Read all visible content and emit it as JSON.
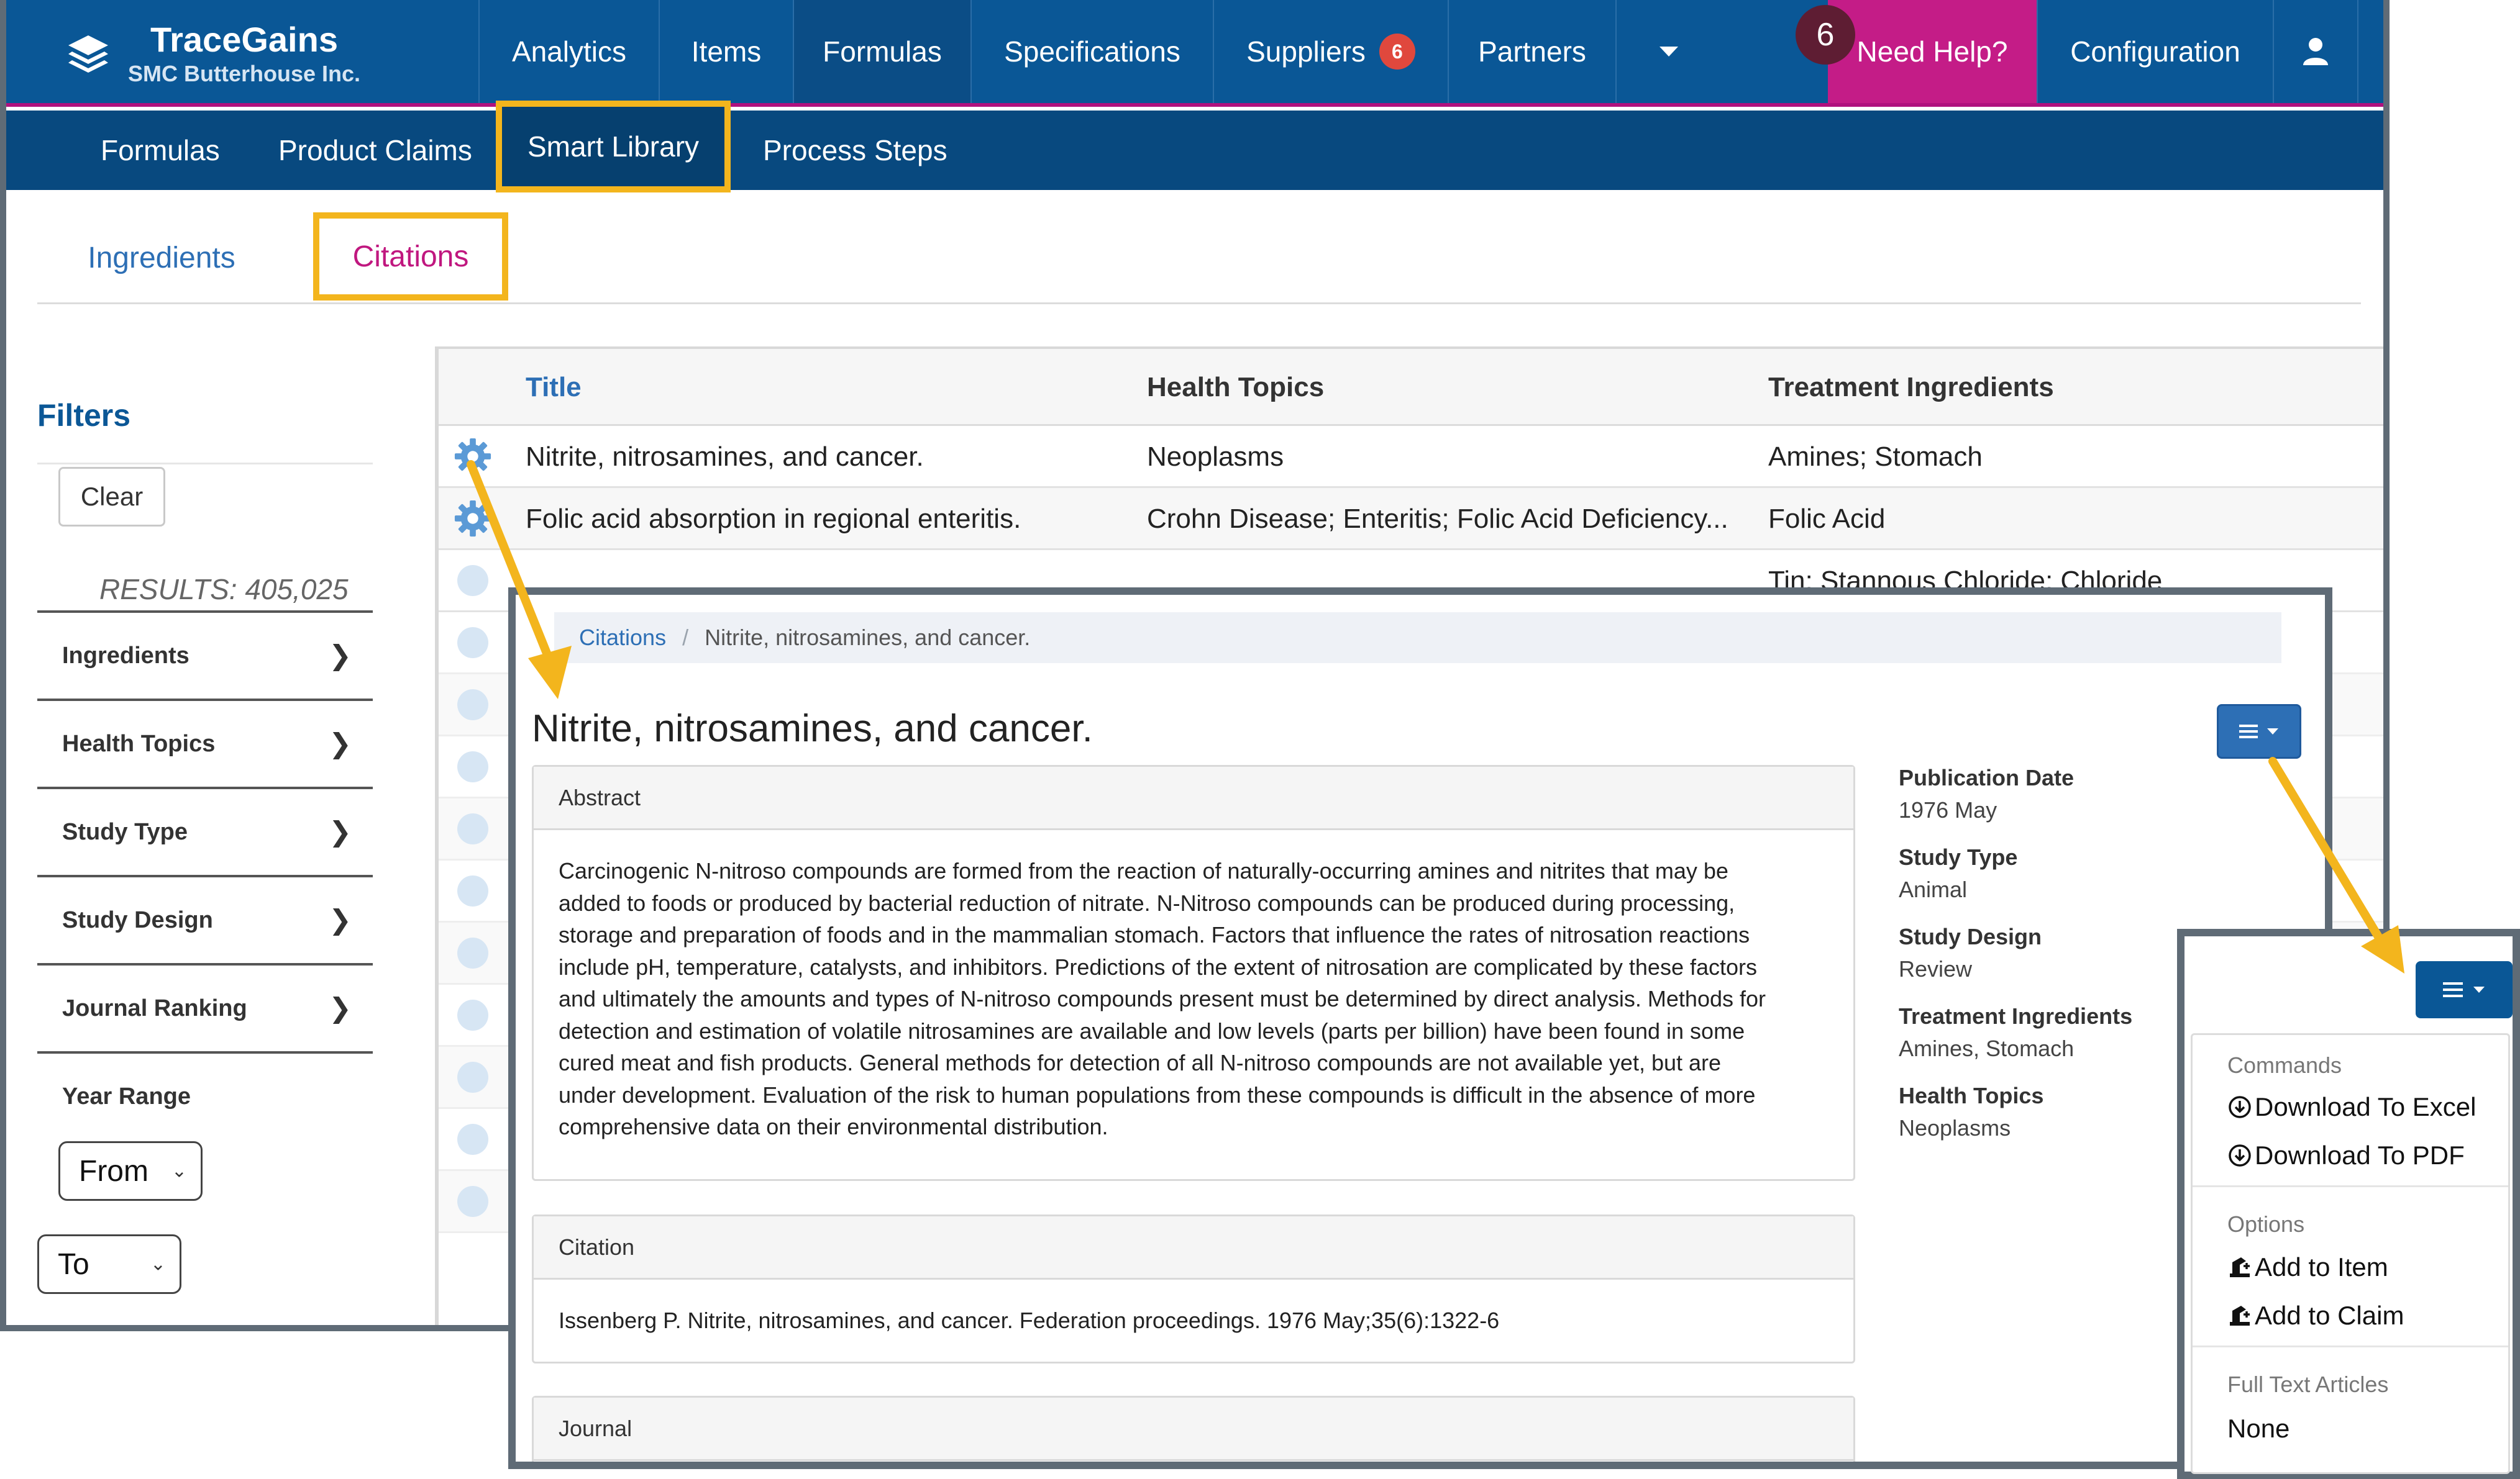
{
  "app": {
    "brand_name": "TraceGains",
    "org_name": "SMC Butterhouse Inc."
  },
  "nav": {
    "items": [
      {
        "label": "Analytics"
      },
      {
        "label": "Items"
      },
      {
        "label": "Formulas",
        "active": true
      },
      {
        "label": "Specifications"
      },
      {
        "label": "Suppliers",
        "badge": "6"
      },
      {
        "label": "Partners"
      }
    ],
    "help_label": "Need Help?",
    "help_count": "6",
    "config_label": "Configuration"
  },
  "subnav": {
    "items": [
      "Formulas",
      "Product Claims",
      "Smart Library",
      "Process Steps"
    ]
  },
  "tabs": {
    "ingredients": "Ingredients",
    "citations": "Citations"
  },
  "filters": {
    "title": "Filters",
    "clear": "Clear",
    "results": "RESULTS: 405,025",
    "facets": [
      "Ingredients",
      "Health Topics",
      "Study Type",
      "Study Design",
      "Journal Ranking"
    ],
    "year_range": "Year Range",
    "from": "From",
    "to": "To"
  },
  "table": {
    "headers": [
      "Title",
      "Health Topics",
      "Treatment Ingredients"
    ],
    "rows": [
      {
        "title": "Nitrite, nitrosamines, and cancer.",
        "topics": "Neoplasms",
        "ingredients": "Amines; Stomach"
      },
      {
        "title": "Folic acid absorption in regional enteritis.",
        "topics": "Crohn Disease; Enteritis; Folic Acid Deficiency...",
        "ingredients": "Folic Acid"
      },
      {
        "title": "",
        "topics": "",
        "ingredients": "Tin; Stannous Chloride; Chloride"
      }
    ]
  },
  "detail": {
    "breadcrumb_root": "Citations",
    "breadcrumb_current": "Nitrite, nitrosamines, and cancer.",
    "title": "Nitrite, nitrosamines, and cancer.",
    "abstract_label": "Abstract",
    "abstract_lines": [
      "Carcinogenic N-nitroso compounds are formed from the reaction of naturally-occurring amines and nitrites that may be",
      "added to foods or produced by bacterial reduction of nitrate. N-Nitroso compounds can be produced during processing,",
      "storage and preparation of foods and in the mammalian stomach. Factors that influence the rates of nitrosation reactions",
      "include pH, temperature, catalysts, and inhibitors. Predictions of the extent of nitrosation are complicated by these factors",
      "and ultimately the amounts and types of N-nitroso compounds present must be determined by direct analysis. Methods for",
      "detection and estimation of volatile nitrosamines are available and low levels (parts per billion) have been found in some",
      "cured meat and fish products. General methods for detection of all N-nitroso compounds are not available yet, but are",
      "under development. Evaluation of the risk to human populations from these compounds is difficult in the absence of more",
      "comprehensive data on their environmental distribution."
    ],
    "citation_label": "Citation",
    "citation_text": "Issenberg P. Nitrite, nitrosamines, and cancer. Federation proceedings. 1976 May;35(6):1322-6",
    "journal_label": "Journal",
    "meta": [
      {
        "label": "Publication Date",
        "value": "1976 May"
      },
      {
        "label": "Study Type",
        "value": "Animal"
      },
      {
        "label": "Study Design",
        "value": "Review"
      },
      {
        "label": "Treatment Ingredients",
        "value": "Amines, Stomach"
      },
      {
        "label": "Health Topics",
        "value": "Neoplasms"
      }
    ]
  },
  "dropdown": {
    "commands_label": "Commands",
    "download_excel": "Download To Excel",
    "download_pdf": "Download To PDF",
    "options_label": "Options",
    "add_item": "Add to Item",
    "add_claim": "Add to Claim",
    "fulltext_label": "Full Text Articles",
    "fulltext_value": "None"
  },
  "colors": {
    "header_blue": "#0a5796",
    "subnav_blue": "#08497f",
    "help_magenta": "#c41c87",
    "highlight_gold": "#f3b51d",
    "link_blue": "#2d6fb5",
    "active_tab_magenta": "#c0177f"
  },
  "icons": [
    "layers-logo-icon",
    "user-icon",
    "caret-down-icon",
    "gear-icon",
    "chevron-right-icon",
    "list-menu-icon",
    "download-circle-icon",
    "add-to-icon"
  ]
}
